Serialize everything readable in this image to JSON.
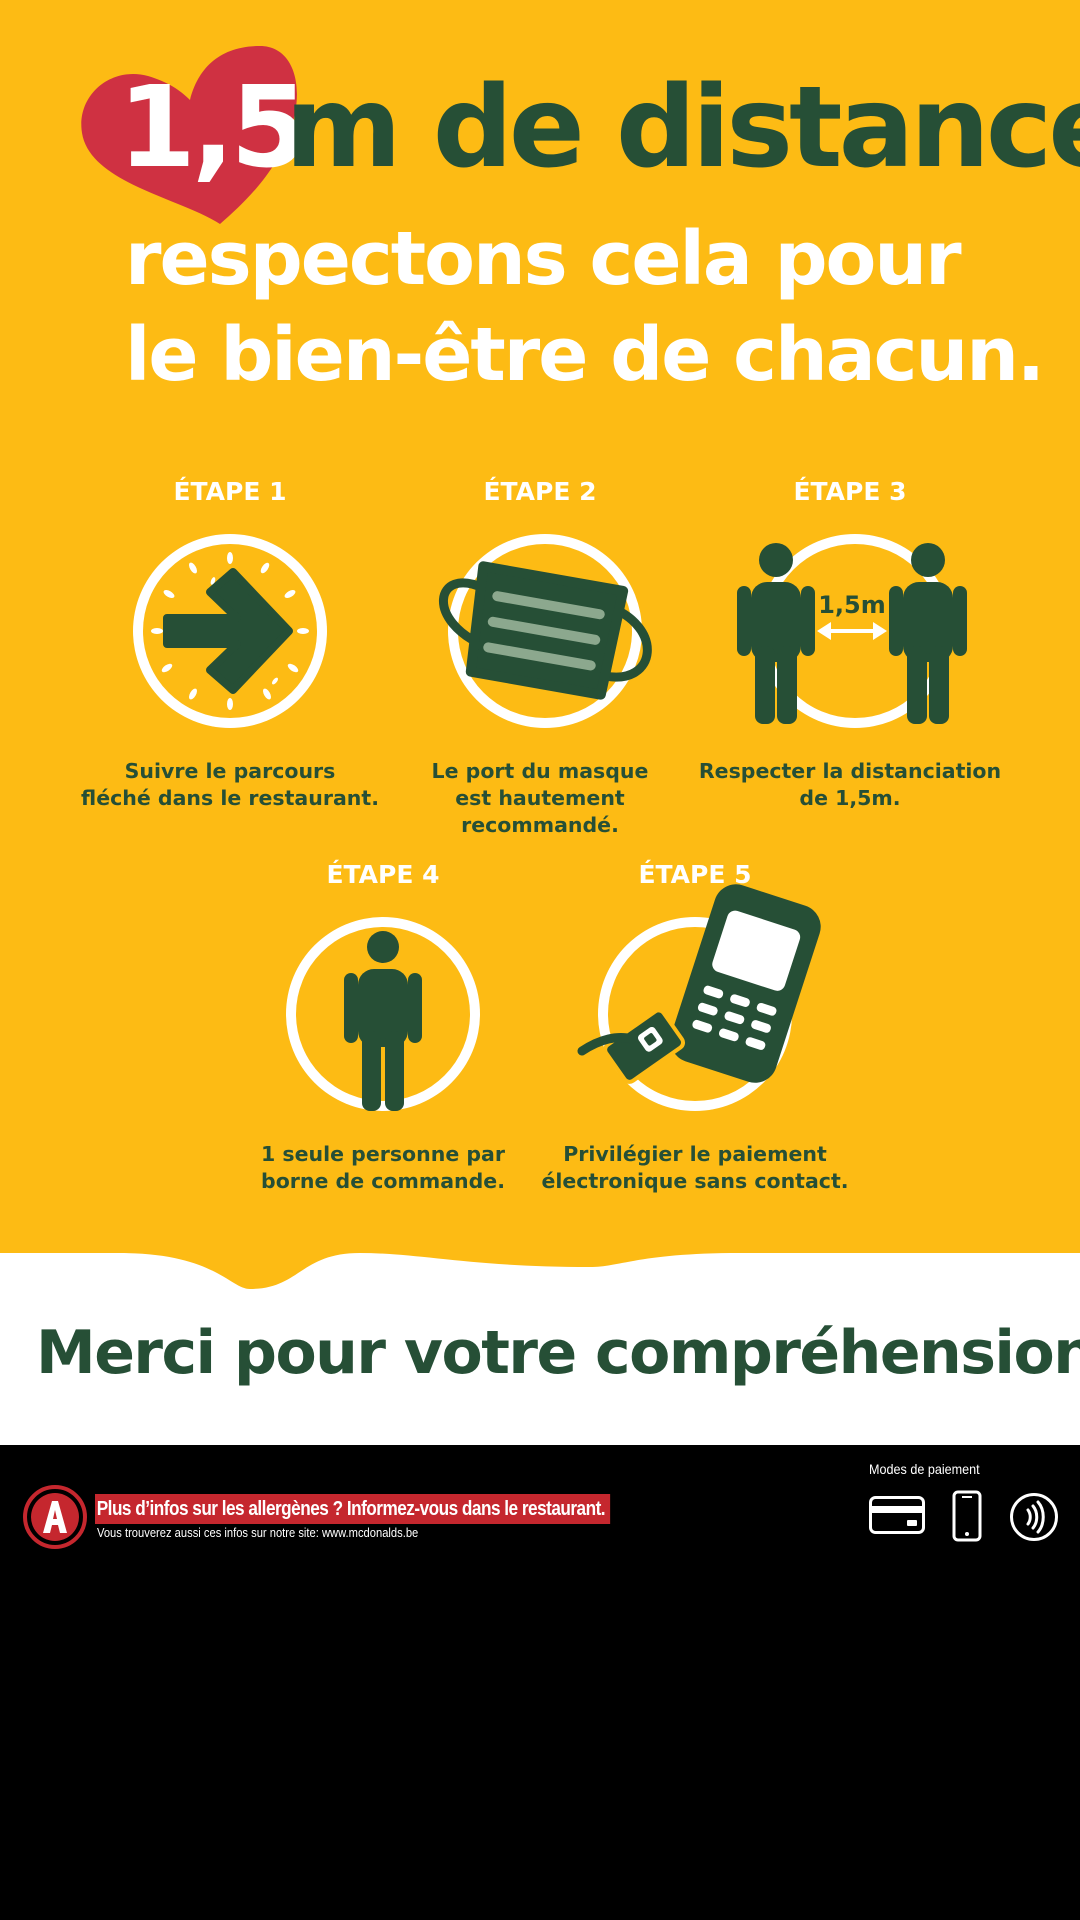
{
  "headline": {
    "highlight": "1,5",
    "rest": "m de distance,",
    "line2": "respectons cela pour",
    "line3": "le bien-être de chacun."
  },
  "steps": [
    {
      "label": "ÉTAPE 1",
      "text": "Suivre le parcours\nfléché dans le restaurant.",
      "icon": "arrow-icon"
    },
    {
      "label": "ÉTAPE 2",
      "text": "Le port du masque\nest hautement\nrecommandé.",
      "icon": "face-mask-icon"
    },
    {
      "label": "ÉTAPE 3",
      "text": "Respecter la distanciation\nde 1,5m.",
      "icon": "social-distance-icon",
      "distance_label": "1,5m"
    },
    {
      "label": "ÉTAPE 4",
      "text": "1 seule personne par\nborne de commande.",
      "icon": "single-person-icon"
    },
    {
      "label": "ÉTAPE 5",
      "text": "Privilégier le paiement\nélectronique sans contact.",
      "icon": "contactless-payment-icon"
    }
  ],
  "thanks": "Merci pour votre compréhension.",
  "footer": {
    "allergen_title": "Plus d’infos sur les allergènes ? Informez-vous dans le restaurant.",
    "allergen_sub": "Vous trouverez aussi ces infos sur notre site: www.mcdonalds.be",
    "payment_label": "Modes de paiement",
    "payment_icons": [
      "credit-card-icon",
      "smartphone-icon",
      "contactless-icon"
    ]
  },
  "colors": {
    "background_yellow": "#FDBB14",
    "dark_green": "#264F36",
    "heart_red": "#CF3142",
    "allergen_red": "#C5272E",
    "white": "#FFFFFF",
    "black": "#000000"
  }
}
